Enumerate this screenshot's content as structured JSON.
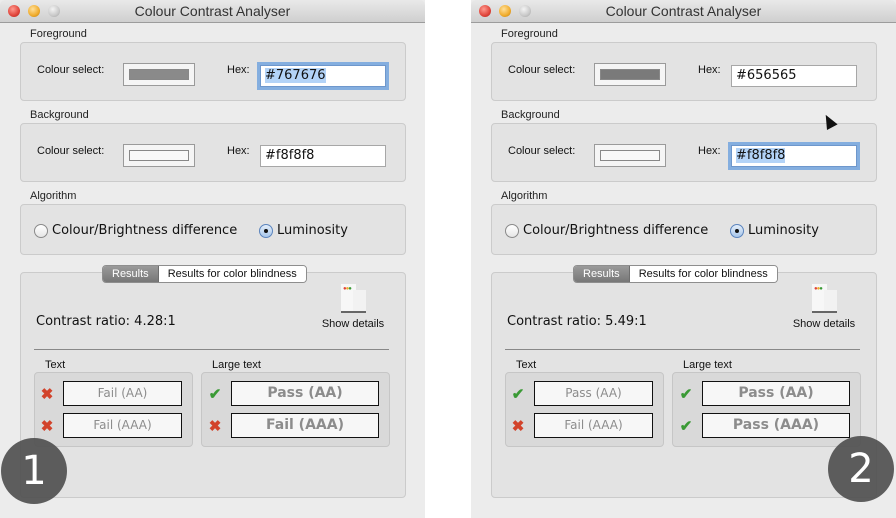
{
  "windows": [
    {
      "title": "Colour Contrast Analyser",
      "foreground": {
        "label": "Foreground",
        "colour_select_label": "Colour select:",
        "hex_label": "Hex:",
        "hex_value": "#767676",
        "swatch_color": "#8a8a8a",
        "focused": true
      },
      "background": {
        "label": "Background",
        "colour_select_label": "Colour select:",
        "hex_label": "Hex:",
        "hex_value": "#f8f8f8",
        "swatch_color": "#f8f8f8",
        "focused": false
      },
      "algorithm": {
        "label": "Algorithm",
        "options": [
          "Colour/Brightness difference",
          "Luminosity"
        ],
        "selected": "Luminosity"
      },
      "tabs": [
        "Results",
        "Results for color blindness"
      ],
      "active_tab": "Results",
      "contrast_ratio": "Contrast ratio: 4.28:1",
      "show_details": "Show details",
      "text_label": "Text",
      "large_text_label": "Large text",
      "text_results": [
        {
          "status": "fail",
          "label": "Fail (AA)"
        },
        {
          "status": "fail",
          "label": "Fail (AAA)"
        }
      ],
      "large_text_results": [
        {
          "status": "pass",
          "label": "Pass (AA)"
        },
        {
          "status": "fail",
          "label": "Fail (AAA)"
        }
      ],
      "badge": "1"
    },
    {
      "title": "Colour Contrast Analyser",
      "foreground": {
        "label": "Foreground",
        "colour_select_label": "Colour select:",
        "hex_label": "Hex:",
        "hex_value": "#656565",
        "swatch_color": "#7a7a7a",
        "focused": false
      },
      "background": {
        "label": "Background",
        "colour_select_label": "Colour select:",
        "hex_label": "Hex:",
        "hex_value": "#f8f8f8",
        "swatch_color": "#f8f8f8",
        "focused": true
      },
      "algorithm": {
        "label": "Algorithm",
        "options": [
          "Colour/Brightness difference",
          "Luminosity"
        ],
        "selected": "Luminosity"
      },
      "tabs": [
        "Results",
        "Results for color blindness"
      ],
      "active_tab": "Results",
      "contrast_ratio": "Contrast ratio: 5.49:1",
      "show_details": "Show details",
      "text_label": "Text",
      "large_text_label": "Large text",
      "text_results": [
        {
          "status": "pass",
          "label": "Pass (AA)"
        },
        {
          "status": "fail",
          "label": "Fail (AAA)"
        }
      ],
      "large_text_results": [
        {
          "status": "pass",
          "label": "Pass (AA)"
        },
        {
          "status": "pass",
          "label": "Pass (AAA)"
        }
      ],
      "badge": "2"
    }
  ],
  "icons": {
    "pass": "✔",
    "fail": "✖"
  },
  "colors": {
    "pass": "#3a9a35",
    "fail": "#d2432b",
    "focus_ring": "#84aedf"
  }
}
